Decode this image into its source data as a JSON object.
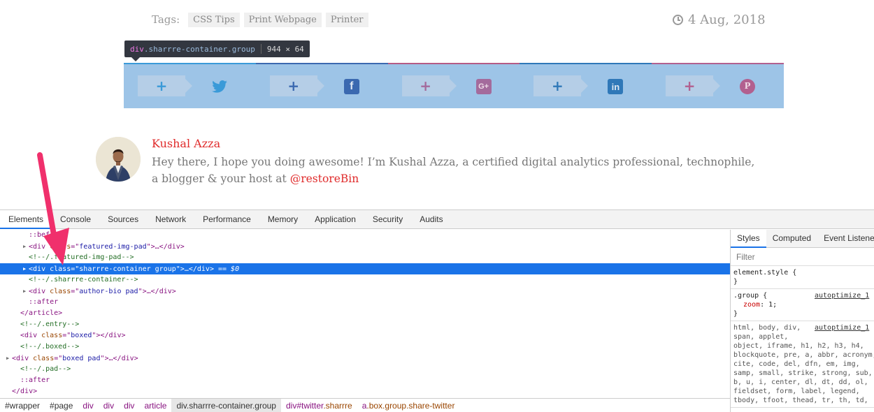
{
  "page": {
    "tags_label": "Tags:",
    "tags": [
      "CSS Tips",
      "Print Webpage",
      "Printer"
    ],
    "date": "4 Aug, 2018",
    "tooltip": {
      "tag": "div",
      "classes": ".sharrre-container.group",
      "size": "944 × 64"
    },
    "share_buttons": [
      {
        "count": "+",
        "icon": "twitter-icon",
        "color": "#3a9ad8"
      },
      {
        "count": "+",
        "icon": "facebook-icon",
        "color": "#3b69b0"
      },
      {
        "count": "+",
        "icon": "google-plus-icon",
        "color": "#a46b9c"
      },
      {
        "count": "+",
        "icon": "linkedin-icon",
        "color": "#2f78b8"
      },
      {
        "count": "+",
        "icon": "pinterest-icon",
        "color": "#b2608f"
      }
    ],
    "author": {
      "name": "Kushal Azza",
      "bio": "Hey there, I hope you doing awesome! I’m Kushal Azza, a certified digital analytics professional, technophile, a blogger & your host at ",
      "handle": "@restoreBin"
    }
  },
  "devtools": {
    "tabs": [
      "Elements",
      "Console",
      "Sources",
      "Network",
      "Performance",
      "Memory",
      "Application",
      "Security",
      "Audits"
    ],
    "active_tab": "Elements",
    "dom": [
      {
        "indent": 3,
        "tri": "",
        "kind": "pseudo",
        "text": "::before"
      },
      {
        "indent": 3,
        "tri": "▶",
        "kind": "el",
        "tag": "div",
        "attr": "class",
        "val": "featured-img-pad",
        "rest": ">…</div>"
      },
      {
        "indent": 3,
        "tri": "",
        "kind": "comment",
        "text": "<!--/.featured-img-pad-->"
      },
      {
        "indent": 3,
        "tri": "▶",
        "kind": "el",
        "tag": "div",
        "attr": "class",
        "val": "sharrre-container group",
        "rest": ">…</div>",
        "selected": true,
        "suffix": " == $0"
      },
      {
        "indent": 3,
        "tri": "",
        "kind": "comment",
        "text": "<!--/.sharrre-container-->"
      },
      {
        "indent": 3,
        "tri": "▶",
        "kind": "el",
        "tag": "div",
        "attr": "class",
        "val": "author-bio pad",
        "rest": ">…</div>"
      },
      {
        "indent": 3,
        "tri": "",
        "kind": "pseudo",
        "text": "::after"
      },
      {
        "indent": 2,
        "tri": "",
        "kind": "close",
        "text": "</article>"
      },
      {
        "indent": 2,
        "tri": "",
        "kind": "comment",
        "text": "<!--/.entry-->"
      },
      {
        "indent": 2,
        "tri": "",
        "kind": "el",
        "tag": "div",
        "attr": "class",
        "val": "boxed",
        "rest": "></div>"
      },
      {
        "indent": 2,
        "tri": "",
        "kind": "comment",
        "text": "<!--/.boxed-->"
      },
      {
        "indent": 1,
        "tri": "▶",
        "kind": "el",
        "tag": "div",
        "attr": "class",
        "val": "boxed pad",
        "rest": ">…</div>"
      },
      {
        "indent": 2,
        "tri": "",
        "kind": "comment",
        "text": "<!--/.pad-->"
      },
      {
        "indent": 2,
        "tri": "",
        "kind": "pseudo",
        "text": "::after"
      },
      {
        "indent": 1,
        "tri": "",
        "kind": "close",
        "text": "</div>"
      }
    ],
    "breadcrumb": [
      {
        "text": "#wrapper",
        "style": "gray"
      },
      {
        "text": "#page",
        "style": "gray"
      },
      {
        "text": "div",
        "style": "tag"
      },
      {
        "text": "div",
        "style": "tag"
      },
      {
        "text": "div",
        "style": "tag"
      },
      {
        "text": "article",
        "style": "tag"
      },
      {
        "text": "div.sharrre-container.group",
        "style": "active"
      },
      {
        "text": "div#twitter",
        "cls": ".sharrre",
        "style": "tag"
      },
      {
        "text": "a",
        "cls": ".box.group.share-twitter",
        "style": "tag"
      }
    ],
    "styles": {
      "tabs": [
        "Styles",
        "Computed",
        "Event Listeners"
      ],
      "active_tab": "Styles",
      "filter_placeholder": "Filter",
      "element_style": "element.style {",
      "close_brace": "}",
      "group_rule": {
        "selector": ".group {",
        "source": "autoptimize_1",
        "prop": "zoom",
        "value": "1;"
      },
      "reset_rule": {
        "source": "autoptimize_1",
        "lines": [
          "html, body, div,",
          "span, applet,",
          "object, iframe, h1, h2, h3, h4,",
          "blockquote, pre, a, abbr, acronym,",
          "cite, code, del, dfn, em, img,",
          "samp, small, strike, strong, sub,",
          "b, u, i, center, dl, dt, dd, ol,",
          "fieldset, form, label, legend,",
          "tbody, tfoot, thead, tr, th, td,"
        ]
      }
    }
  }
}
